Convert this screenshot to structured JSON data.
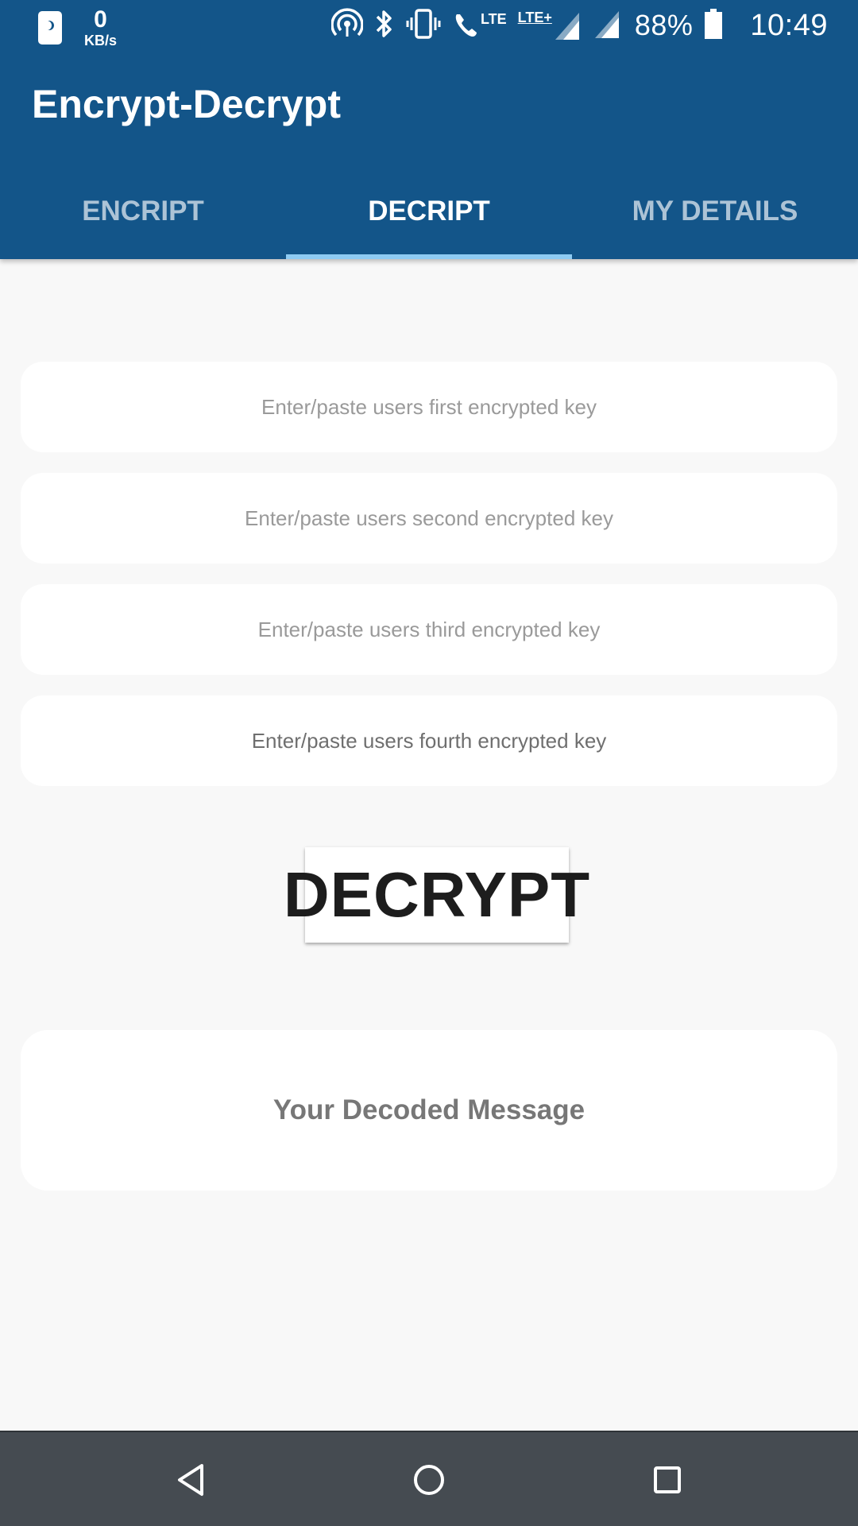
{
  "status_bar": {
    "speed_value": "0",
    "speed_unit": "KB/s",
    "network_1": "LTE",
    "network_2": "LTE+",
    "battery": "88%",
    "time": "10:49"
  },
  "app": {
    "title": "Encrypt-Decrypt"
  },
  "tabs": [
    {
      "label": "ENCRIPT",
      "active": false
    },
    {
      "label": "DECRIPT",
      "active": true
    },
    {
      "label": "MY DETAILS",
      "active": false
    }
  ],
  "fields": [
    {
      "placeholder": "Enter/paste users first encrypted key"
    },
    {
      "placeholder": "Enter/paste users second encrypted key"
    },
    {
      "placeholder": "Enter/paste users third encrypted key"
    },
    {
      "placeholder": "Enter/paste users fourth encrypted key"
    }
  ],
  "actions": {
    "decrypt_label": "DECRYPT"
  },
  "result": {
    "placeholder": "Your Decoded Message"
  },
  "colors": {
    "app_bar": "#135589",
    "tab_indicator": "#8ecbf3",
    "background": "#f8f8f8",
    "nav_bar": "#454b51"
  },
  "icons": {
    "status_left": [
      "do-not-disturb-phone-icon"
    ],
    "status_right": [
      "hotspot-icon",
      "bluetooth-icon",
      "vibrate-icon",
      "volte-call-icon",
      "signal-icon",
      "battery-icon"
    ],
    "navigation": [
      "back-icon",
      "home-icon",
      "recents-icon"
    ]
  }
}
